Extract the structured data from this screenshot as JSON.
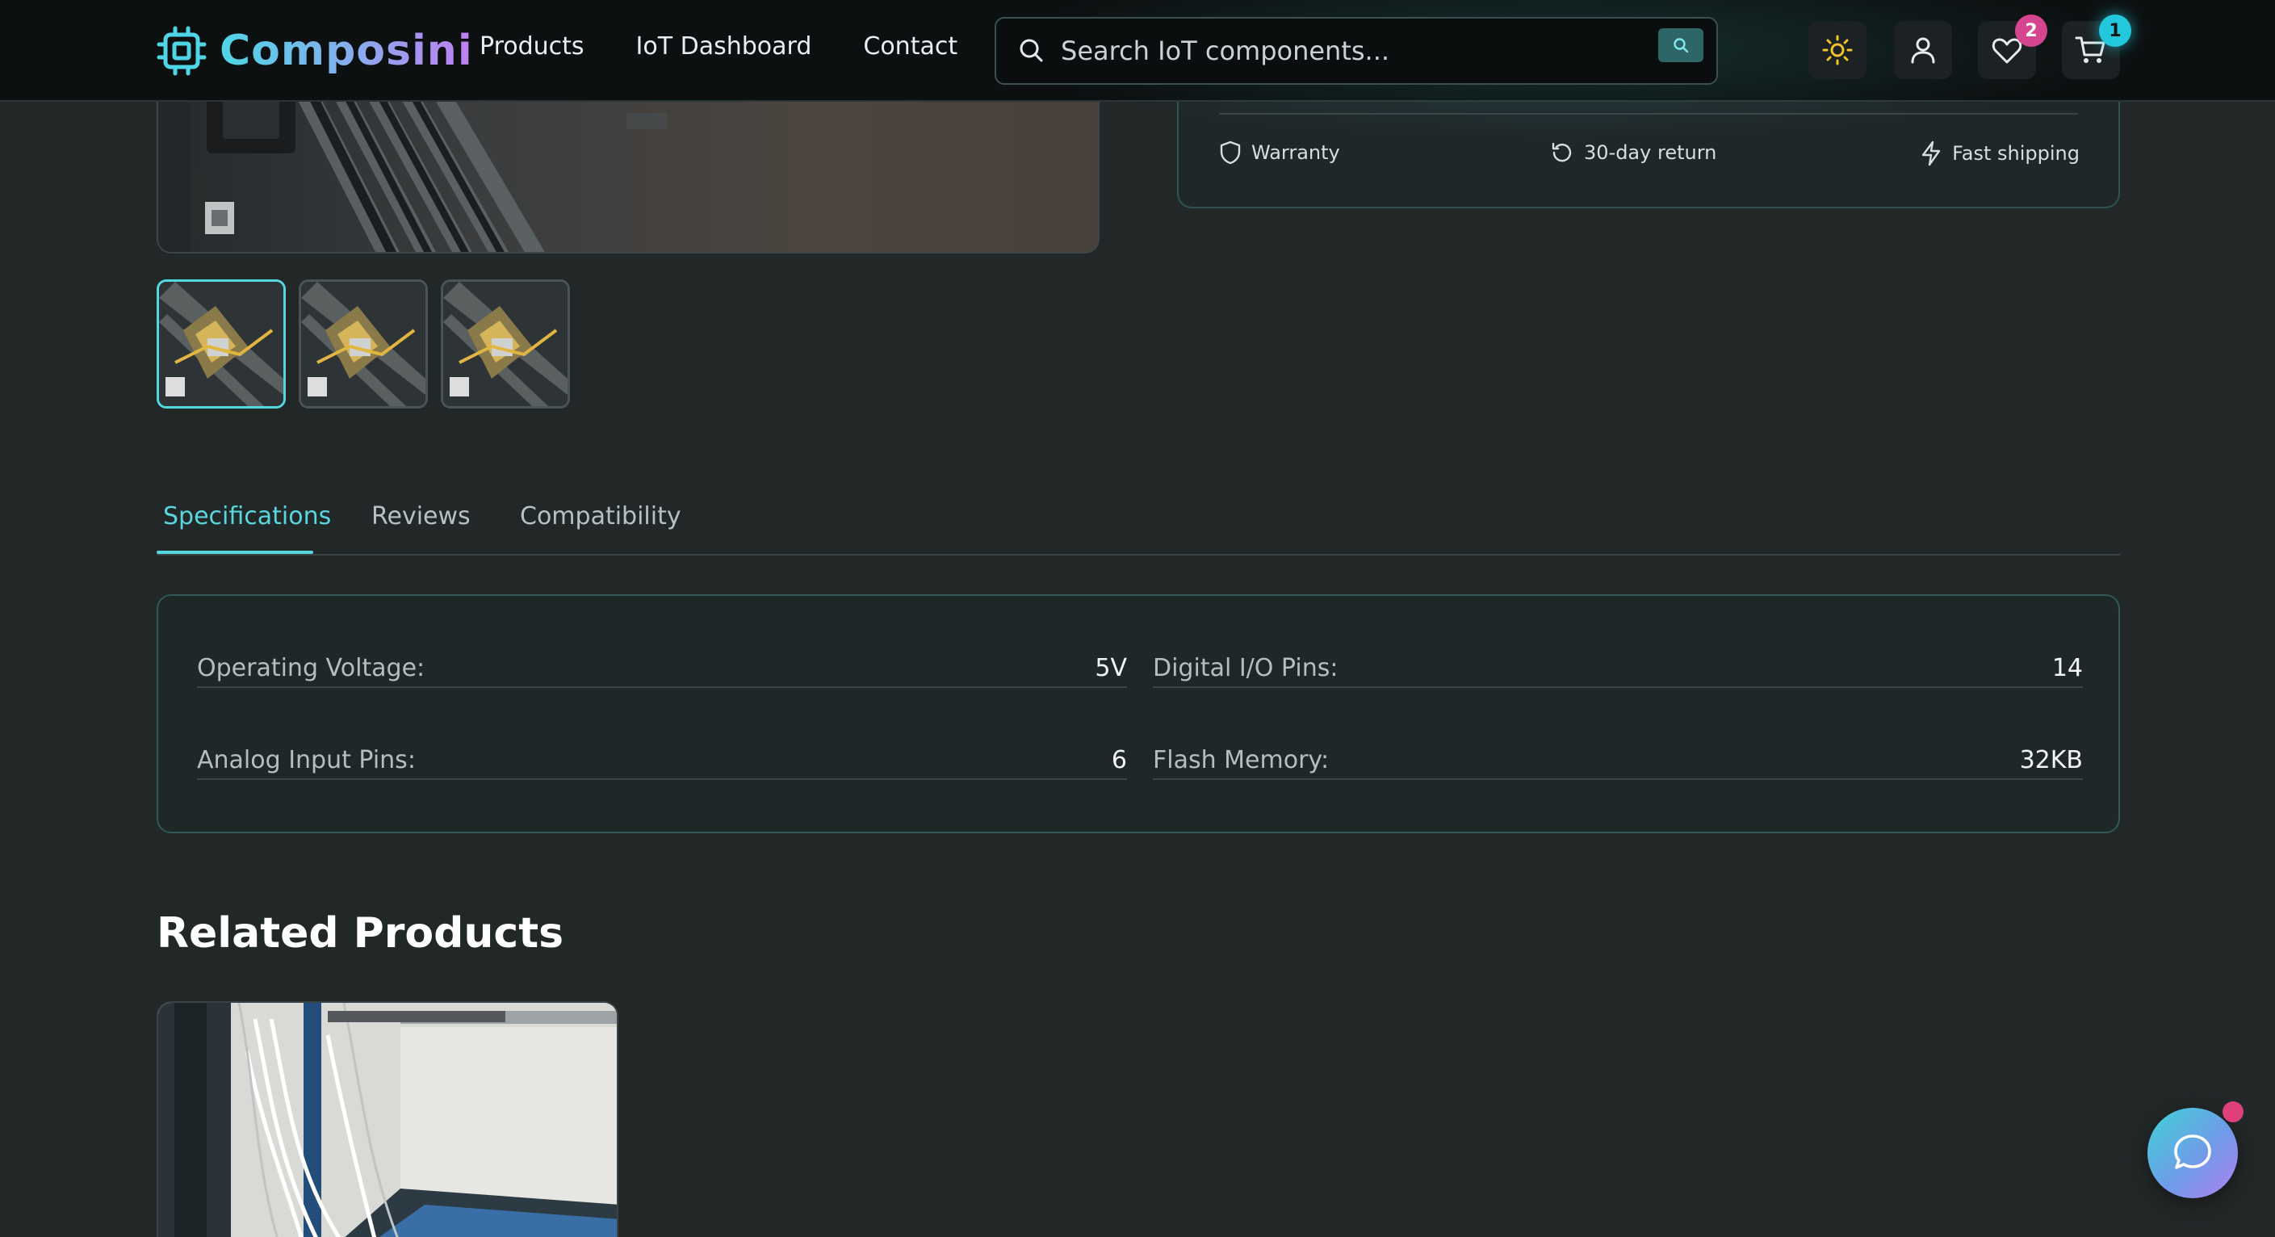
{
  "brand": {
    "name": "Composini",
    "logo_icon": "chip-icon"
  },
  "nav": {
    "links": [
      "Products",
      "IoT Dashboard",
      "Contact"
    ]
  },
  "search": {
    "placeholder": "Search IoT components...",
    "value": ""
  },
  "header_actions": {
    "theme_icon": "sun-icon",
    "account_icon": "user-icon",
    "wishlist": {
      "icon": "heart-icon",
      "count": "2"
    },
    "cart": {
      "icon": "cart-icon",
      "count": "1"
    }
  },
  "product_perks": [
    "Warranty",
    "30-day return",
    "Fast shipping"
  ],
  "gallery": {
    "thumbnail_count": 3,
    "active_index": 0
  },
  "tabs": {
    "items": [
      "Specifications",
      "Reviews",
      "Compatibility"
    ],
    "active": "Specifications"
  },
  "specifications": [
    {
      "label": "Operating Voltage:",
      "value": "5V"
    },
    {
      "label": "Digital I/O Pins:",
      "value": "14"
    },
    {
      "label": "Analog Input Pins:",
      "value": "6"
    },
    {
      "label": "Flash Memory:",
      "value": "32KB"
    }
  ],
  "related": {
    "title": "Related Products"
  },
  "chat": {
    "icon": "chat-bubble-icon",
    "has_notification": true
  },
  "colors": {
    "accent": "#5ad6df",
    "badge_pink": "#d64590",
    "badge_cyan": "#24c8dc",
    "background": "#222728"
  }
}
